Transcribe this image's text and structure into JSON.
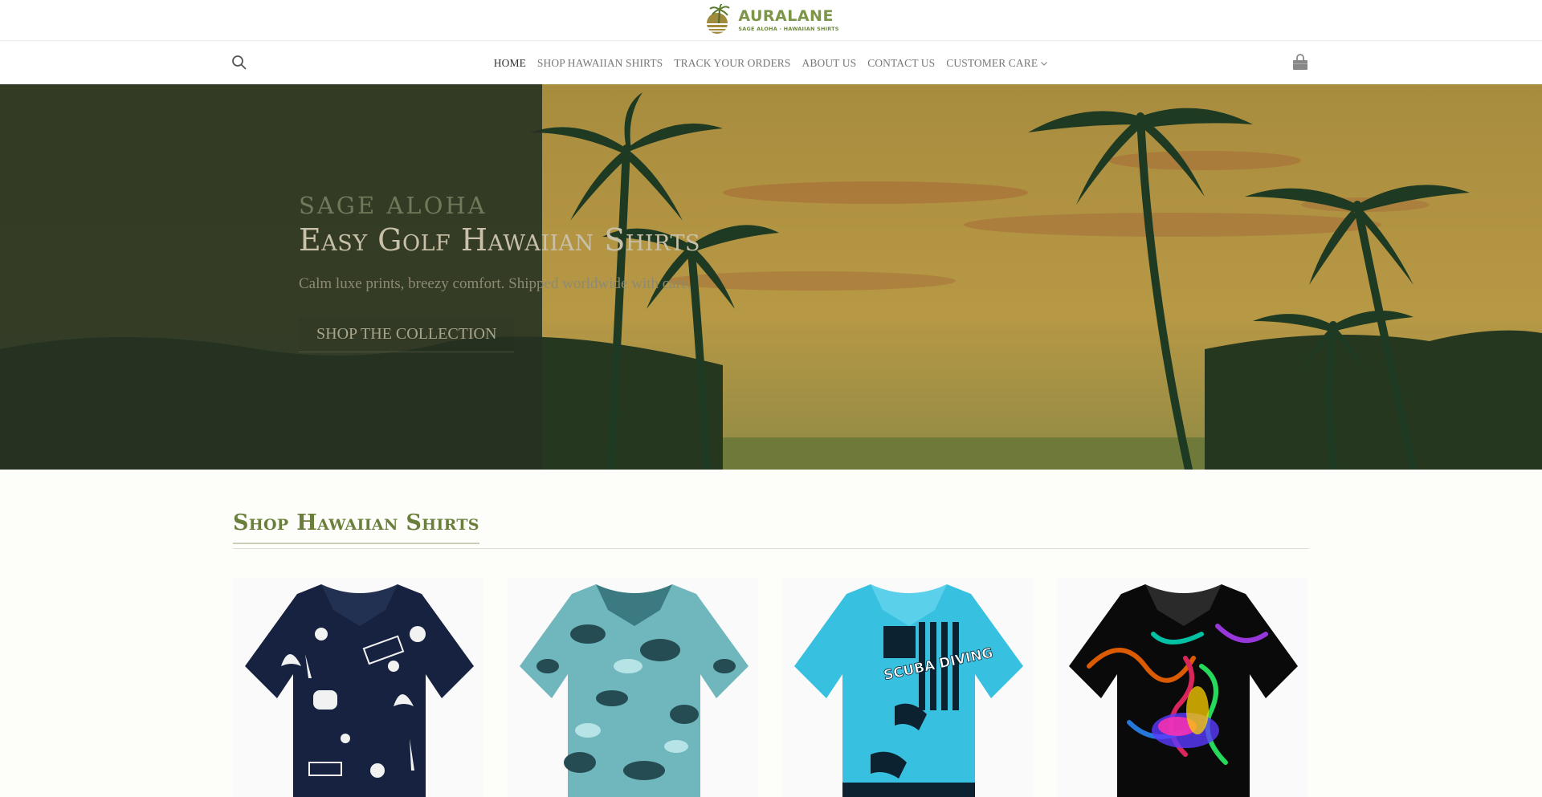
{
  "brand": {
    "name": "AURALANE",
    "tagline": "SAGE ALOHA · HAWAIIAN SHIRTS",
    "color": "#7d9549"
  },
  "nav": {
    "items": [
      {
        "label": "HOME",
        "active": true
      },
      {
        "label": "SHOP HAWAIIAN SHIRTS",
        "active": false
      },
      {
        "label": "TRACK YOUR ORDERS",
        "active": false
      },
      {
        "label": "ABOUT US",
        "active": false
      },
      {
        "label": "CONTACT US",
        "active": false
      },
      {
        "label": "CUSTOMER CARE",
        "active": false,
        "has_dropdown": true
      }
    ],
    "search_icon": "search-icon",
    "cart_icon": "shopping-bag-icon"
  },
  "hero": {
    "eyebrow": "SAGE ALOHA",
    "title": "Easy Golf Hawaiian Shirts",
    "subtitle": "Calm luxe prints, breezy comfort. Shipped worldwide with care.",
    "cta": "SHOP THE COLLECTION"
  },
  "section": {
    "title": "Shop Hawaiian Shirts"
  },
  "products": [
    {
      "print": "navy-sports-palm",
      "text": ""
    },
    {
      "print": "teal-camo-diver",
      "text": ""
    },
    {
      "print": "blue-scuba-flag",
      "text": "SCUBA DIVING"
    },
    {
      "print": "black-rainbow-smoke",
      "text": ""
    }
  ],
  "colors": {
    "accent": "#6a7f3c",
    "hero_dark": "#263222",
    "hero_sky": "#b39443"
  }
}
